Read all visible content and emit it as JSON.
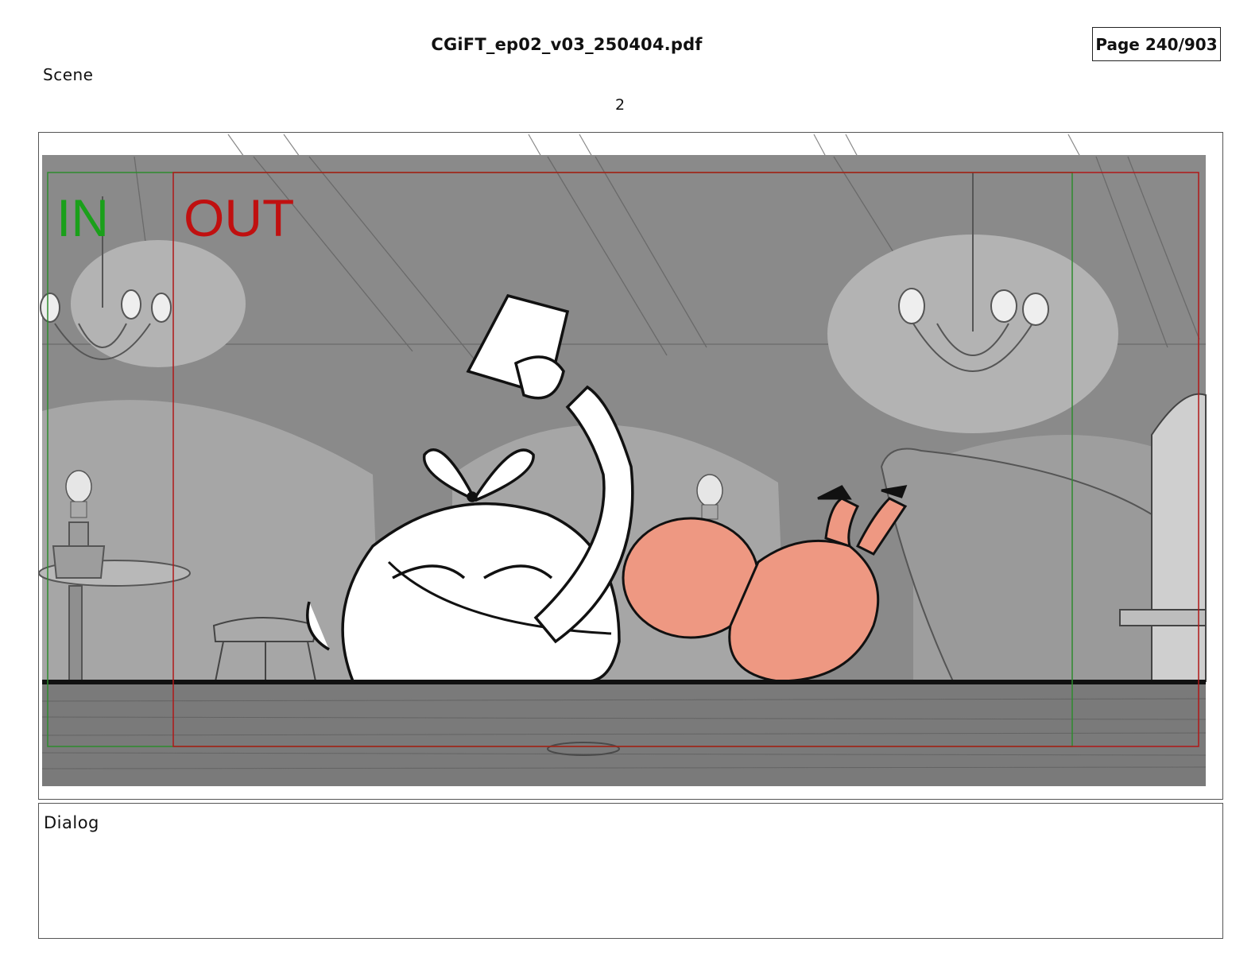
{
  "document": {
    "filename": "CGiFT_ep02_v03_250404.pdf",
    "page": "Page 240/903"
  },
  "scene": {
    "label": "Scene",
    "number": "2"
  },
  "panel": {
    "in_marker": "IN",
    "out_marker": "OUT",
    "colors": {
      "in_frame": "#2e8b2e",
      "out_frame": "#b01818",
      "in_text": "#1aa01a",
      "out_text": "#c01010",
      "crab": "#ee9882",
      "background_grey": "#8a8a8a"
    }
  },
  "dialog": {
    "label": "Dialog"
  }
}
